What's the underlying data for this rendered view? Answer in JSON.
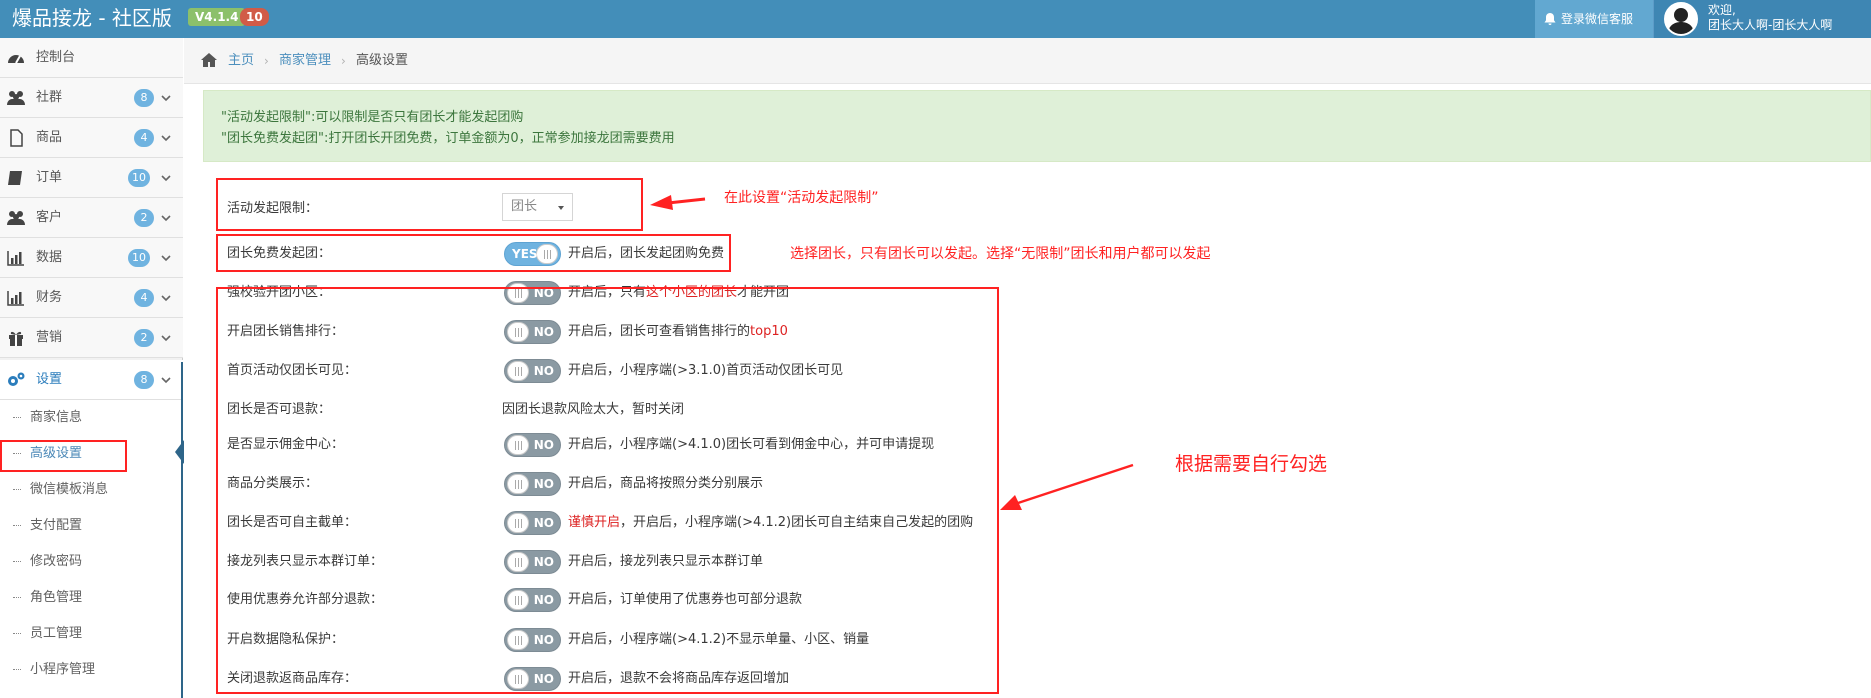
{
  "navbar": {
    "brand": "爆品接龙 - 社区版",
    "version": "V4.1.4",
    "count": "10",
    "notice": "登录微信客服",
    "user_greeting": "欢迎,",
    "user_name": "团长大人啊-团长大人啊"
  },
  "sidebar": {
    "items": [
      {
        "label": "控制台",
        "icon": "dashboard-icon"
      },
      {
        "label": "社群",
        "count": "8",
        "icon": "users-icon"
      },
      {
        "label": "商品",
        "count": "4",
        "icon": "file-icon"
      },
      {
        "label": "订单",
        "count": "10",
        "icon": "book-icon"
      },
      {
        "label": "客户",
        "count": "2",
        "icon": "users-icon"
      },
      {
        "label": "数据",
        "count": "10",
        "icon": "bar-chart-icon"
      },
      {
        "label": "财务",
        "count": "4",
        "icon": "bar-chart-icon"
      },
      {
        "label": "营销",
        "count": "2",
        "icon": "gift-icon"
      },
      {
        "label": "设置",
        "count": "8",
        "icon": "cogs-icon"
      }
    ],
    "submenu": [
      "商家信息",
      "高级设置",
      "微信模板消息",
      "支付配置",
      "修改密码",
      "角色管理",
      "员工管理",
      "小程序管理"
    ]
  },
  "breadcrumb": {
    "home": "主页",
    "section": "商家管理",
    "current": "高级设置"
  },
  "alert": {
    "line1": "\"活动发起限制\":可以限制是否只有团长才能发起团购",
    "line2": "\"团长免费发起团\":打开团长开团免费，订单金额为0，正常参加接龙团需要费用"
  },
  "form": {
    "activity_limit": {
      "label": "活动发起限制：",
      "value": "团长"
    },
    "free_group": {
      "label": "团长免费发起团：",
      "toggle": "YES",
      "desc": "开启后，团长发起团购免费"
    },
    "rows": [
      {
        "label": "强校验开团小区：",
        "toggle": "NO",
        "desc_pre": "开启后，只有",
        "desc_red": "这个小区的团长",
        "desc_post": "才能开团"
      },
      {
        "label": "开启团长销售排行：",
        "toggle": "NO",
        "desc_pre": "开启后，团长可查看销售排行的",
        "desc_red": "top10",
        "desc_post": ""
      },
      {
        "label": "首页活动仅团长可见：",
        "toggle": "NO",
        "desc_pre": "开启后，小程序端(>3.1.0)首页活动仅团长可见",
        "desc_red": "",
        "desc_post": ""
      },
      {
        "label": "团长是否可退款：",
        "toggle": "",
        "desc_pre": "因团长退款风险太大，暂时关闭",
        "desc_red": "",
        "desc_post": ""
      },
      {
        "label": "是否显示佣金中心：",
        "toggle": "NO",
        "desc_pre": "开启后，小程序端(>4.1.0)团长可看到佣金中心，并可申请提现",
        "desc_red": "",
        "desc_post": ""
      },
      {
        "label": "商品分类展示：",
        "toggle": "NO",
        "desc_pre": "开启后，商品将按照分类分别展示",
        "desc_red": "",
        "desc_post": ""
      },
      {
        "label": "团长是否可自主截单：",
        "toggle": "NO",
        "desc_pre": "",
        "desc_red": "谨慎开启",
        "desc_post": "，开启后，小程序端(>4.1.2)团长可自主结束自己发起的团购"
      },
      {
        "label": "接龙列表只显示本群订单：",
        "toggle": "NO",
        "desc_pre": "开启后，接龙列表只显示本群订单",
        "desc_red": "",
        "desc_post": ""
      },
      {
        "label": "使用优惠券允许部分退款：",
        "toggle": "NO",
        "desc_pre": "开启后，订单使用了优惠券也可部分退款",
        "desc_red": "",
        "desc_post": ""
      },
      {
        "label": "开启数据隐私保护：",
        "toggle": "NO",
        "desc_pre": "开启后，小程序端(>4.1.2)不显示单量、小区、销量",
        "desc_red": "",
        "desc_post": ""
      },
      {
        "label": "关闭退款返商品库存：",
        "toggle": "NO",
        "desc_pre": "开启后，退款不会将商品库存返回增加",
        "desc_red": "",
        "desc_post": ""
      }
    ]
  },
  "annotations": {
    "a1": "在此设置“活动发起限制”",
    "a2": "选择团长，只有团长可以发起。选择“无限制”团长和用户都可以发起",
    "a3": "根据需要自行勾选",
    "color": "#ff2222"
  },
  "colors": {
    "navbar": "#438eb9",
    "accent": "#6fb3e0",
    "alert_bg": "#dff0d8",
    "alert_text": "#3c763d"
  }
}
